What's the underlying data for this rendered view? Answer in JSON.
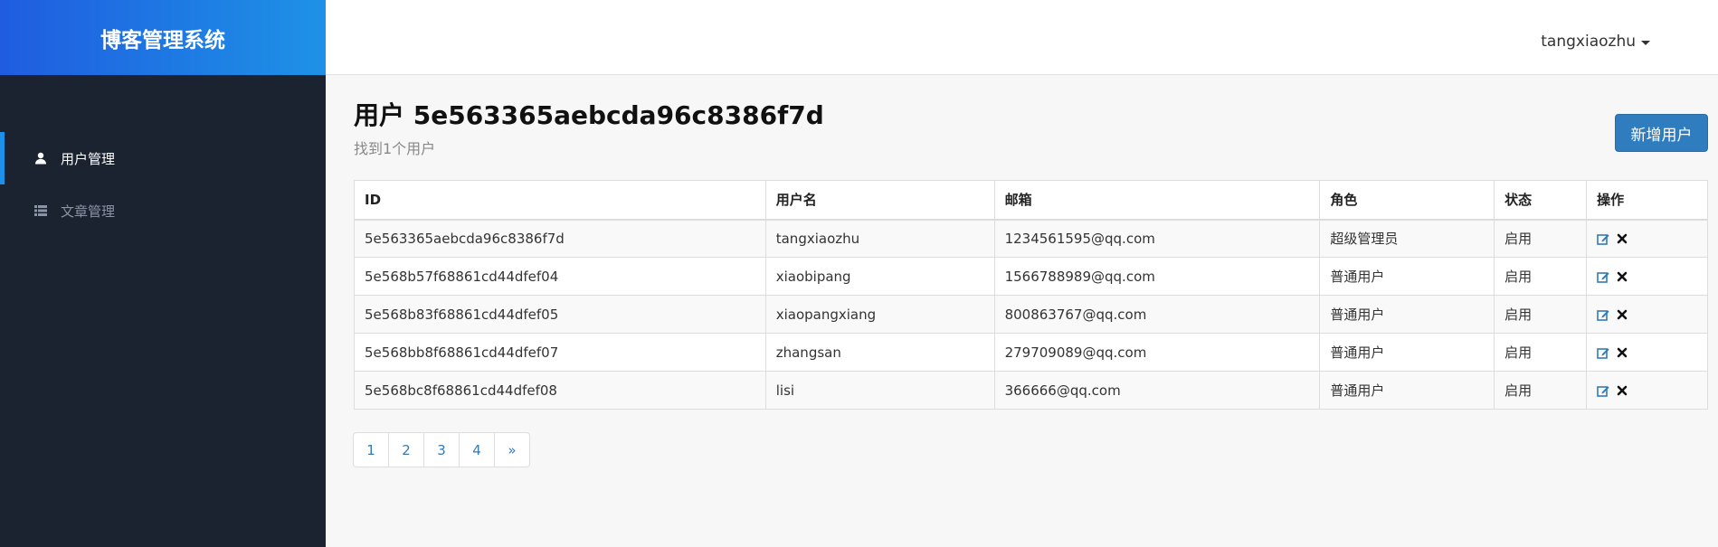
{
  "app": {
    "title": "博客管理系统"
  },
  "sidebar": {
    "items": [
      {
        "label": "用户管理",
        "icon": "user-icon",
        "active": true
      },
      {
        "label": "文章管理",
        "icon": "list-icon",
        "active": false
      }
    ]
  },
  "header": {
    "username": "tangxiaozhu"
  },
  "main": {
    "title": "用户 5e563365aebcda96c8386f7d",
    "subtitle": "找到1个用户",
    "add_button": "新增用户"
  },
  "table": {
    "columns": [
      "ID",
      "用户名",
      "邮箱",
      "角色",
      "状态",
      "操作"
    ],
    "rows": [
      {
        "id": "5e563365aebcda96c8386f7d",
        "username": "tangxiaozhu",
        "email": "1234561595@qq.com",
        "role": "超级管理员",
        "status": "启用"
      },
      {
        "id": "5e568b57f68861cd44dfef04",
        "username": "xiaobipang",
        "email": "1566788989@qq.com",
        "role": "普通用户",
        "status": "启用"
      },
      {
        "id": "5e568b83f68861cd44dfef05",
        "username": "xiaopangxiang",
        "email": "800863767@qq.com",
        "role": "普通用户",
        "status": "启用"
      },
      {
        "id": "5e568bb8f68861cd44dfef07",
        "username": "zhangsan",
        "email": "279709089@qq.com",
        "role": "普通用户",
        "status": "启用"
      },
      {
        "id": "5e568bc8f68861cd44dfef08",
        "username": "lisi",
        "email": "366666@qq.com",
        "role": "普通用户",
        "status": "启用"
      }
    ]
  },
  "pagination": {
    "pages": [
      "1",
      "2",
      "3",
      "4",
      "»"
    ]
  },
  "colors": {
    "accent": "#1e90e8",
    "sidebar_bg": "#1b2230",
    "primary_button": "#2f7dbe",
    "link": "#337ab7"
  }
}
